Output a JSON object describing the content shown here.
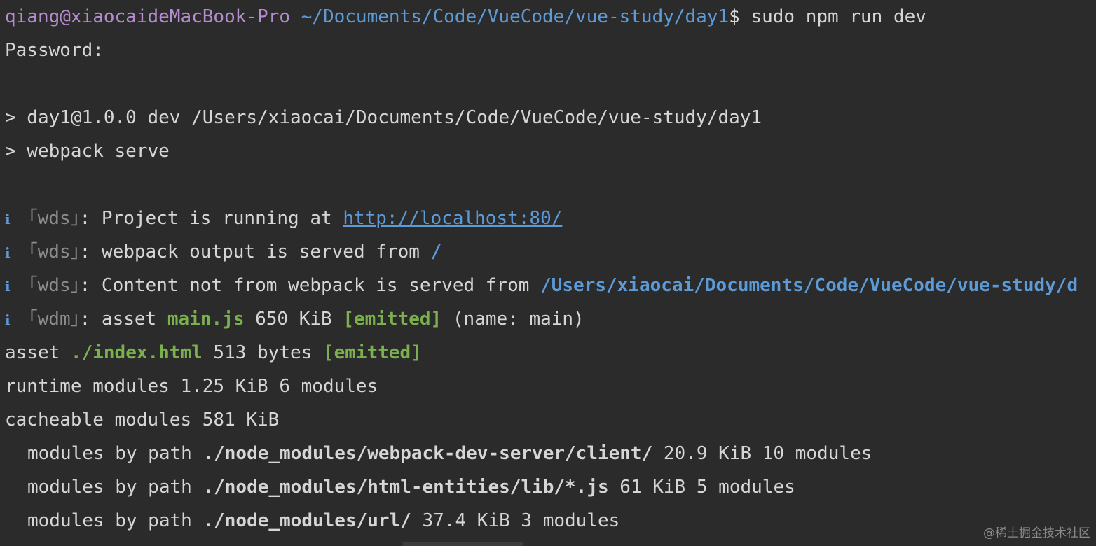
{
  "prompt": {
    "user_host": "qiang@xiaocaideMacBook-Pro",
    "cwd": "~/Documents/Code/VueCode/vue-study/day1",
    "symbol": "$",
    "command": "sudo npm run dev"
  },
  "password_prompt": "Password:",
  "script_lines": [
    "> day1@1.0.0 dev /Users/xiaocai/Documents/Code/VueCode/vue-study/day1",
    "> webpack serve"
  ],
  "info_icon": "i",
  "wds_lines": {
    "tag_wds": "｢wds｣",
    "tag_wdm": "｢wdm｣",
    "project_running": ": Project is running at ",
    "project_url": "http://localhost:80/",
    "output_served": ": webpack output is served from ",
    "output_path": "/",
    "content_not_from": ": Content not from webpack is served from ",
    "content_path": "/Users/xiaocai/Documents/Code/VueCode/vue-study/d",
    "asset_prefix": ": asset ",
    "asset_main": "main.js",
    "asset_main_size": " 650 KiB ",
    "emitted": "[emitted]",
    "asset_main_name": " (name: main)"
  },
  "asset_index": {
    "prefix": "asset ",
    "file": "./index.html",
    "size": " 513 bytes ",
    "emitted": "[emitted]"
  },
  "summary_lines": [
    "runtime modules 1.25 KiB 6 modules",
    "cacheable modules 581 KiB"
  ],
  "module_paths": [
    {
      "prefix": "modules by path ",
      "path": "./node_modules/webpack-dev-server/client/",
      "rest": " 20.9 KiB 10 modules"
    },
    {
      "prefix": "modules by path ",
      "path": "./node_modules/html-entities/lib/*.js",
      "rest": " 61 KiB 5 modules"
    },
    {
      "prefix": "modules by path ",
      "path": "./node_modules/url/",
      "rest": " 37.4 KiB 3 modules"
    }
  ],
  "watermark": "@稀土掘金技术社区",
  "colors": {
    "background": "#2b2b2b",
    "foreground": "#d6d6d6",
    "user": "#b58ccf",
    "path": "#5d9bd8",
    "green": "#7ab04e",
    "gray": "#8c8c8c"
  }
}
